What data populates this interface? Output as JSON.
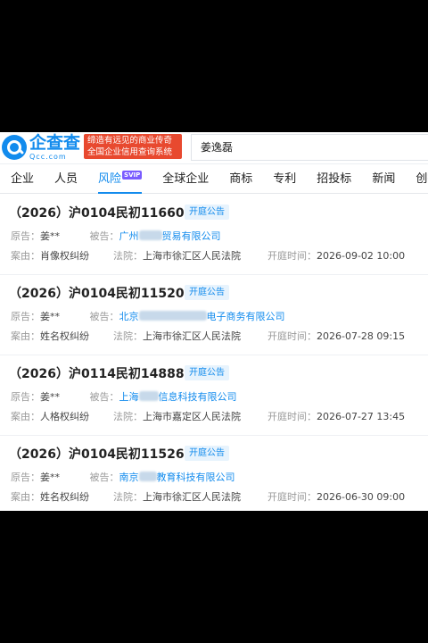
{
  "app": {
    "logo_cn": "企查查",
    "logo_en": "Qcc.com",
    "slogan_line1": "缔造有远见的商业传奇",
    "slogan_line2": "全国企业信用查询系统",
    "search_value": "姜逸磊"
  },
  "tabs": [
    {
      "label": "企业"
    },
    {
      "label": "人员"
    },
    {
      "label": "风险",
      "badge": "SVIP"
    },
    {
      "label": "全球企业"
    },
    {
      "label": "商标"
    },
    {
      "label": "专利"
    },
    {
      "label": "招投标"
    },
    {
      "label": "新闻"
    },
    {
      "label": "创投库"
    }
  ],
  "labels": {
    "plaintiff": "原告：",
    "defendant": "被告：",
    "cause": "案由：",
    "court": "法院：",
    "hearing_time": "开庭时间："
  },
  "cases": [
    {
      "title": "（2026）沪0104民初11660号",
      "badge": "开庭公告",
      "plaintiff": "姜**",
      "defendant_prefix": "广州",
      "defendant_suffix": "贸易有限公司",
      "cause": "肖像权纠纷",
      "court": "上海市徐汇区人民法院",
      "time": "2026-09-02 10:00"
    },
    {
      "title": "（2026）沪0104民初11520号",
      "badge": "开庭公告",
      "plaintiff": "姜**",
      "defendant_prefix": "北京",
      "defendant_suffix": "电子商务有限公司",
      "cause": "姓名权纠纷",
      "court": "上海市徐汇区人民法院",
      "time": "2026-07-28 09:15"
    },
    {
      "title": "（2026）沪0114民初14888号",
      "badge": "开庭公告",
      "plaintiff": "姜**",
      "defendant_prefix": "上海",
      "defendant_suffix": "信息科技有限公司",
      "cause": "人格权纠纷",
      "court": "上海市嘉定区人民法院",
      "time": "2026-07-27 13:45"
    },
    {
      "title": "（2026）沪0104民初11526号",
      "badge": "开庭公告",
      "plaintiff": "姜**",
      "defendant_prefix": "南京",
      "defendant_suffix": "教育科技有限公司",
      "cause": "姓名权纠纷",
      "court": "上海市徐汇区人民法院",
      "time": "2026-06-30 09:00"
    }
  ]
}
